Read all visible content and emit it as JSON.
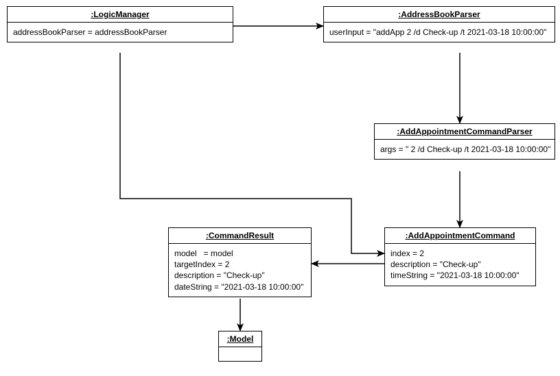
{
  "objects": {
    "logicManager": {
      "title": ":LogicManager",
      "attrs": "addressBookParser = addressBookParser"
    },
    "addressBookParser": {
      "title": ":AddressBookParser",
      "attrs": "userInput = \"addApp 2 /d Check-up /t 2021-03-18 10:00:00\""
    },
    "addAppointmentCommandParser": {
      "title": ":AddAppointmentCommandParser",
      "attrs": "args = \" 2 /d Check-up /t 2021-03-18 10:00:00\""
    },
    "commandResult": {
      "title": ":CommandResult",
      "attrs": "model   = model\ntargetIndex = 2\ndescription = \"Check-up\"\ndateString = \"2021-03-18 10:00:00\""
    },
    "addAppointmentCommand": {
      "title": ":AddAppointmentCommand",
      "attrs": "index = 2\ndescription = \"Check-up\"\ntimeString = \"2021-03-18 10:00:00\""
    },
    "model": {
      "title": ":Model",
      "attrs": ""
    }
  }
}
